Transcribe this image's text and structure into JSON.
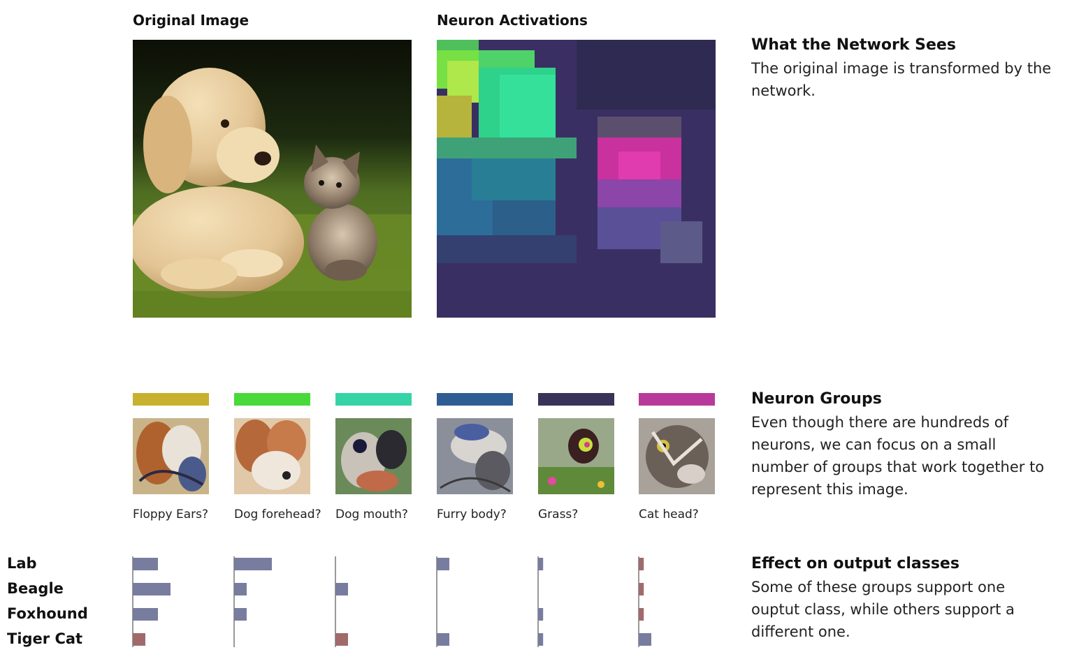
{
  "original": {
    "title": "Original Image"
  },
  "activations": {
    "title": "Neuron Activations",
    "background": "#3a2f63"
  },
  "network_sees": {
    "title": "What the Network Sees",
    "text": "The original image is transformed by the network."
  },
  "neuron_groups": {
    "title": "Neuron Groups",
    "text": "Even though there are hundreds of neurons, we can focus on a small number of groups that work together to represent this image.",
    "groups": [
      {
        "label": "Floppy Ears?",
        "color": "#c8b12e"
      },
      {
        "label": "Dog forehead?",
        "color": "#4ad93a"
      },
      {
        "label": "Dog mouth?",
        "color": "#36d3a6"
      },
      {
        "label": "Furry body?",
        "color": "#2e5d94"
      },
      {
        "label": "Grass?",
        "color": "#3a3359"
      },
      {
        "label": "Cat head?",
        "color": "#b8399a"
      }
    ]
  },
  "effect": {
    "title": "Effect on output classes",
    "text": "Some of these groups support one ouptut class, while others support a different one.",
    "classes": [
      "Lab",
      "Beagle",
      "Foxhound",
      "Tiger Cat"
    ],
    "positive_color": "#787c9e",
    "negative_color": "#a06a6a"
  },
  "chart_data": {
    "type": "bar",
    "categories": [
      "Lab",
      "Beagle",
      "Foxhound",
      "Tiger Cat"
    ],
    "series": [
      {
        "name": "Floppy Ears?",
        "values": [
          2,
          3,
          2,
          1
        ]
      },
      {
        "name": "Dog forehead?",
        "values": [
          3,
          1,
          1,
          0
        ]
      },
      {
        "name": "Dog mouth?",
        "values": [
          0,
          1,
          0,
          1
        ]
      },
      {
        "name": "Furry body?",
        "values": [
          1,
          0,
          0,
          1
        ]
      },
      {
        "name": "Grass?",
        "values": [
          0.4,
          0,
          0.4,
          0.4
        ]
      },
      {
        "name": "Cat head?",
        "values": [
          0.4,
          0.4,
          0.4,
          1
        ]
      }
    ]
  }
}
